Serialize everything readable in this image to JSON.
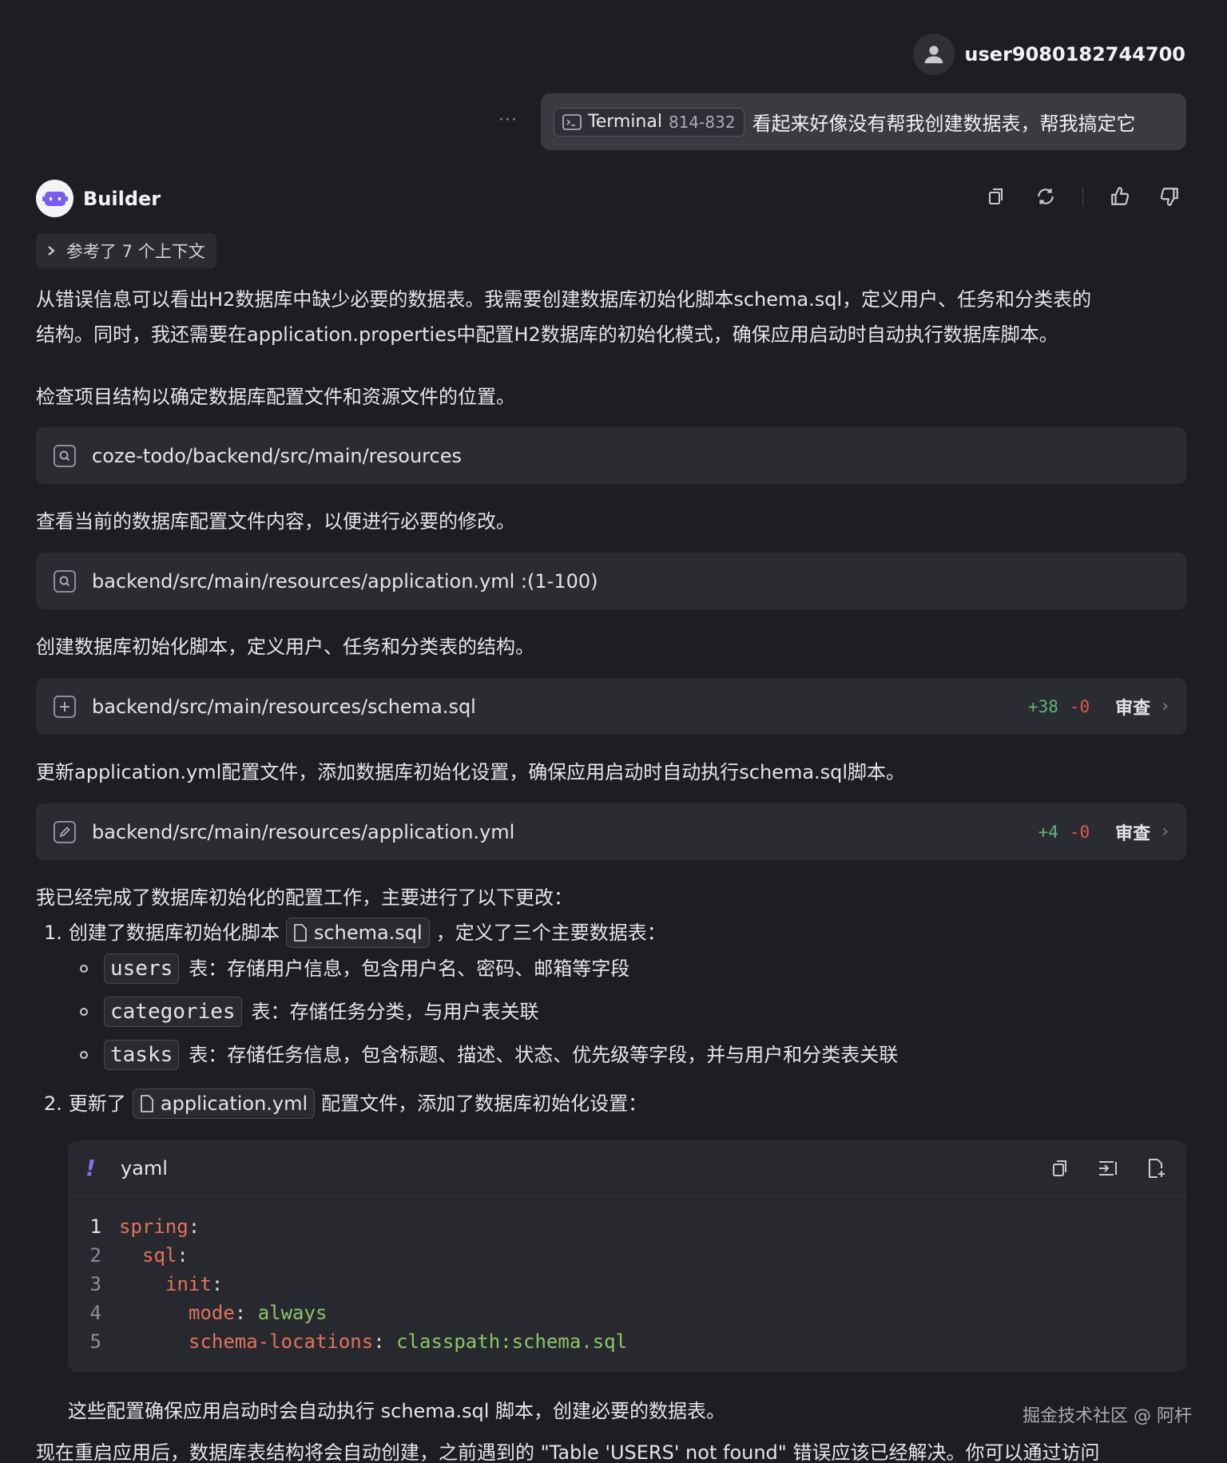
{
  "user": {
    "name": "user9080182744700"
  },
  "more": "···",
  "user_message": {
    "terminal_label": "Terminal",
    "terminal_range": "814-832",
    "text": "看起来好像没有帮我创建数据表，帮我搞定它"
  },
  "builder": {
    "name": "Builder"
  },
  "context": {
    "label": "参考了 7 个上下文"
  },
  "paragraphs": {
    "p1_line1": "从错误信息可以看出H2数据库中缺少必要的数据表。我需要创建数据库初始化脚本schema.sql，定义用户、任务和分类表的",
    "p1_line2": "结构。同时，我还需要在application.properties中配置H2数据库的初始化模式，确保应用启动时自动执行数据库脚本。",
    "p2": "检查项目结构以确定数据库配置文件和资源文件的位置。",
    "p3": "查看当前的数据库配置文件内容，以便进行必要的修改。",
    "p4": "创建数据库初始化脚本，定义用户、任务和分类表的结构。",
    "p5": "更新application.yml配置文件，添加数据库初始化设置，确保应用启动时自动执行schema.sql脚本。",
    "p6": "我已经完成了数据库初始化的配置工作，主要进行了以下更改：",
    "p7": "这些配置确保应用启动时会自动执行 schema.sql 脚本，创建必要的数据表。",
    "p8": "现在重启应用后，数据库表结构将会自动创建，之前遇到的 \"Table 'USERS' not found\" 错误应该已经解决。你可以通过访问"
  },
  "tools": [
    {
      "path": "coze-todo/backend/src/main/resources",
      "icon": "search-icon"
    },
    {
      "path": "backend/src/main/resources/application.yml :(1-100)",
      "icon": "search-icon"
    },
    {
      "path": "backend/src/main/resources/schema.sql",
      "icon": "plus-icon",
      "added": "+38",
      "removed": "-0",
      "review": "审查"
    },
    {
      "path": "backend/src/main/resources/application.yml",
      "icon": "edit-icon",
      "added": "+4",
      "removed": "-0",
      "review": "审查"
    }
  ],
  "list": {
    "item1": {
      "num": "1.",
      "pre": "创建了数据库初始化脚本",
      "file": "schema.sql",
      "post": "，定义了三个主要数据表："
    },
    "sub": [
      {
        "code": "users",
        "text": "表：存储用户信息，包含用户名、密码、邮箱等字段"
      },
      {
        "code": "categories",
        "text": "表：存储任务分类，与用户表关联"
      },
      {
        "code": "tasks",
        "text": "表：存储任务信息，包含标题、描述、状态、优先级等字段，并与用户和分类表关联"
      }
    ],
    "item2": {
      "num": "2.",
      "pre": "更新了",
      "file": "application.yml",
      "post": "配置文件，添加了数据库初始化设置："
    }
  },
  "code": {
    "lang_icon": "!",
    "lang": "yaml",
    "lines": [
      {
        "n": "1",
        "k": "spring",
        "p": ":",
        "v": ""
      },
      {
        "n": "2",
        "k": "sql",
        "p": ":",
        "v": ""
      },
      {
        "n": "3",
        "k": "init",
        "p": ":",
        "v": ""
      },
      {
        "n": "4",
        "k": "mode",
        "p": ": ",
        "v": "always"
      },
      {
        "n": "5",
        "k": "schema-locations",
        "p": ": ",
        "v": "classpath:schema.sql"
      }
    ]
  },
  "watermark": "掘金技术社区 @ 阿杆",
  "colors": {
    "add": "#5fb478",
    "remove": "#e05a4f",
    "yaml_key": "#e1735f",
    "yaml_value": "#8bc46a",
    "accent": "#8b6cf2"
  }
}
